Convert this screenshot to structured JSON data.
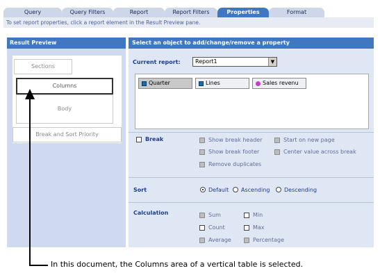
{
  "tabs": [
    {
      "label": "Query"
    },
    {
      "label": "Query Filters"
    },
    {
      "label": "Report"
    },
    {
      "label": "Report Filters"
    },
    {
      "label": "Properties"
    },
    {
      "label": "Format"
    }
  ],
  "hint": "To set report properties, click a report element in the Result Preview pane.",
  "result_preview": {
    "title": "Result Preview",
    "sections": "Sections",
    "columns": "Columns",
    "body": "Body",
    "break_sort": "Break and Sort Priority"
  },
  "properties": {
    "title": "Select an object to add/change/remove a property",
    "current_report_label": "Current report:",
    "current_report_value": "Report1",
    "objects": [
      "Quarter",
      "Lines",
      "Sales revenu"
    ],
    "break": {
      "label": "Break",
      "options": [
        "Show break header",
        "Start on new page",
        "Show break footer",
        "Center value across break",
        "Remove duplicates"
      ]
    },
    "sort": {
      "label": "Sort",
      "options": [
        "Default",
        "Ascending",
        "Descending"
      ],
      "selected": "Default"
    },
    "calculation": {
      "label": "Calculation",
      "options": [
        "Sum",
        "Min",
        "Count",
        "Max",
        "Average",
        "Percentage"
      ]
    }
  },
  "caption": "In this document, the Columns area of a vertical table is selected."
}
